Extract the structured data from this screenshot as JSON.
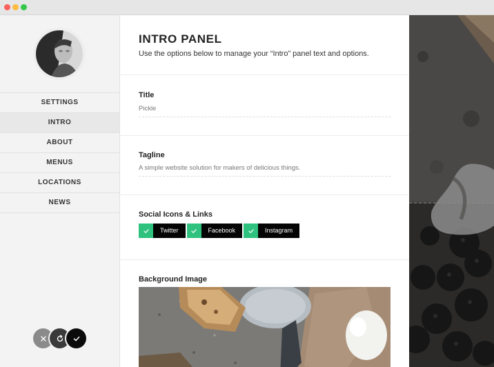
{
  "window": {
    "controls": [
      "close",
      "minimize",
      "zoom"
    ]
  },
  "sidebar": {
    "avatar": "avatar-photo",
    "items": [
      {
        "label": "SETTINGS",
        "active": false
      },
      {
        "label": "INTRO",
        "active": true
      },
      {
        "label": "ABOUT",
        "active": false
      },
      {
        "label": "MENUS",
        "active": false
      },
      {
        "label": "LOCATIONS",
        "active": false
      },
      {
        "label": "NEWS",
        "active": false
      }
    ],
    "actions": [
      "close-icon",
      "refresh-icon",
      "check-icon"
    ]
  },
  "panel": {
    "title": "INTRO PANEL",
    "description": "Use the options below to manage your “Intro” panel text and options.",
    "title_field": {
      "label": "Title",
      "value": "Pickle"
    },
    "tagline_field": {
      "label": "Tagline",
      "value": "A simple website solution for makers of delicious things."
    },
    "social": {
      "label": "Social Icons & Links",
      "links": [
        {
          "name": "Twitter",
          "checked": true
        },
        {
          "name": "Facebook",
          "checked": true
        },
        {
          "name": "Instagram",
          "checked": true
        }
      ]
    },
    "background": {
      "label": "Background Image"
    }
  },
  "colors": {
    "check_green": "#2ec27e",
    "button_dark": "#050505",
    "sidebar_bg": "#f3f3f3"
  }
}
